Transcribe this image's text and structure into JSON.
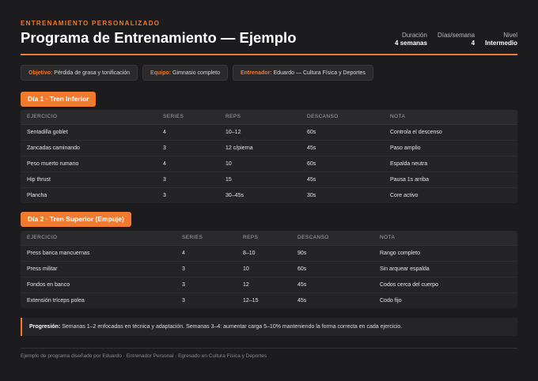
{
  "header": {
    "eyebrow": "ENTRENAMIENTO PERSONALIZADO",
    "title": "Programa de Entrenamiento — Ejemplo",
    "stats": [
      {
        "label": "Duración",
        "value": "4 semanas"
      },
      {
        "label": "Días/semana",
        "value": "4"
      },
      {
        "label": "Nivel",
        "value": "Intermedio"
      }
    ]
  },
  "chips": [
    {
      "key": "Objetivo:",
      "value": "Pérdida de grasa y tonificación"
    },
    {
      "key": "Equipo:",
      "value": "Gimnasio completo"
    },
    {
      "key": "Entrenador:",
      "value": "Eduardo — Cultura Física y Deportes"
    }
  ],
  "columns": [
    "EJERCICIO",
    "SERIES",
    "REPS",
    "DESCANSO",
    "NOTA"
  ],
  "days": [
    {
      "title": "Día 1 · Tren Inferior",
      "rows": [
        [
          "Sentadilla goblet",
          "4",
          "10–12",
          "60s",
          "Controla el descenso"
        ],
        [
          "Zancadas caminando",
          "3",
          "12 c/pierna",
          "45s",
          "Paso amplio"
        ],
        [
          "Peso muerto rumano",
          "4",
          "10",
          "60s",
          "Espalda neutra"
        ],
        [
          "Hip thrust",
          "3",
          "15",
          "45s",
          "Pausa 1s arriba"
        ],
        [
          "Plancha",
          "3",
          "30–45s",
          "30s",
          "Core activo"
        ]
      ]
    },
    {
      "title": "Día 2 · Tren Superior (Empuje)",
      "rows": [
        [
          "Press banca mancuernas",
          "4",
          "8–10",
          "90s",
          "Rango completo"
        ],
        [
          "Press militar",
          "3",
          "10",
          "60s",
          "Sin arquear espalda"
        ],
        [
          "Fondos en banco",
          "3",
          "12",
          "45s",
          "Codos cerca del cuerpo"
        ],
        [
          "Extensión tríceps polea",
          "3",
          "12–15",
          "45s",
          "Codo fijo"
        ]
      ]
    }
  ],
  "progression": {
    "label": "Progresión:",
    "text": "Semanas 1–2 enfocadas en técnica y adaptación. Semanas 3–4: aumentar carga 5–10% manteniendo la forma correcta en cada ejercicio."
  },
  "footer": "Ejemplo de programa diseñado por Eduardo · Entrenador Personal · Egresado en Cultura Física y Deportes",
  "colors": {
    "accent": "#f27a2c",
    "background": "#1c1c1e"
  }
}
